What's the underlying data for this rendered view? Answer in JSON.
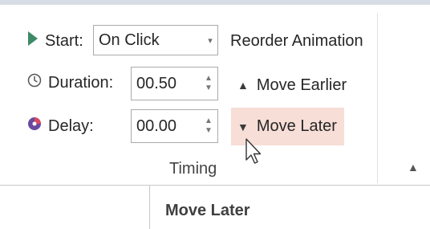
{
  "timing": {
    "start_label": "Start:",
    "start_value": "On Click",
    "duration_label": "Duration:",
    "duration_value": "00.50",
    "delay_label": "Delay:",
    "delay_value": "00.00",
    "group_title": "Timing"
  },
  "reorder": {
    "title": "Reorder Animation",
    "move_earlier": "Move Earlier",
    "move_later": "Move Later"
  },
  "tooltip": {
    "title": "Move Later"
  },
  "icons": {
    "start": "play-triangle-icon",
    "duration": "clock-icon",
    "delay": "delay-icon",
    "dropdown": "chevron-down-icon",
    "spin_up": "spin-up-icon",
    "spin_down": "spin-down-icon",
    "move_earlier": "triangle-up-icon",
    "move_later": "triangle-down-icon",
    "collapse": "chevron-up-icon",
    "cursor": "mouse-pointer-icon"
  },
  "colors": {
    "accent_green": "#3d8a67",
    "hover_fill": "#f7ded7",
    "border": "#ababab"
  }
}
